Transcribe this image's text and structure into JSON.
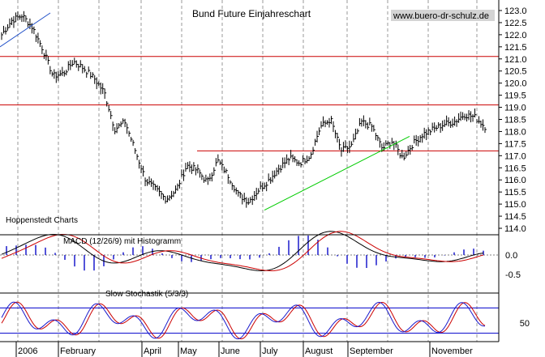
{
  "chart_data": [
    {
      "type": "line",
      "title": "Bund Future Einjahreschart",
      "source": "www.buero-dr-schulz.de",
      "publisher": "Hoppenstedt Charts",
      "ylim": [
        114.0,
        123.5
      ],
      "y_ticks": [
        "123.0",
        "122.5",
        "122.0",
        "121.5",
        "121.0",
        "120.5",
        "120.0",
        "119.5",
        "119.0",
        "118.5",
        "118.0",
        "117.5",
        "117.0",
        "116.5",
        "116.0",
        "115.5",
        "115.0",
        "114.5",
        "114.0"
      ],
      "x_labels": [
        "2006",
        "February",
        "April",
        "May",
        "June",
        "July",
        "August",
        "September",
        "November"
      ],
      "series": [
        {
          "values": [
            122.0,
            122.6,
            122.8,
            122.3,
            121.4,
            120.3,
            120.4,
            120.9,
            120.6,
            120.2,
            119.6,
            118.1,
            118.4,
            117.2,
            116.0,
            115.6,
            115.2,
            115.6,
            116.6,
            116.4,
            115.9,
            116.8,
            116.2,
            115.4,
            115.1,
            115.6,
            116.0,
            116.5,
            116.9,
            116.7,
            117.0,
            118.2,
            118.5,
            117.2,
            117.4,
            118.4,
            118.2,
            117.3,
            117.6,
            116.9,
            117.5,
            117.9,
            118.1,
            118.3,
            118.4,
            118.7,
            118.6,
            118.2
          ]
        }
      ],
      "horizontal_lines": [
        121.1,
        119.1,
        117.2
      ],
      "trendlines": [
        {
          "color": "#2050c8",
          "from": [
            0,
            121.7
          ],
          "to": [
            8,
            123.1
          ]
        },
        {
          "color": "#00cc00",
          "from": [
            60,
            114.8
          ],
          "to": [
            160,
            117.7
          ]
        }
      ]
    },
    {
      "type": "line",
      "title": "MACD (12/26/9) mit Histogramm",
      "ylim": [
        -0.8,
        0.7
      ],
      "y_ticks": [
        "0.0",
        "-0.5"
      ]
    },
    {
      "type": "line",
      "title": "Slow Stochastik (5/3/3)",
      "ylim": [
        0,
        100
      ],
      "y_ticks": [
        "50"
      ]
    }
  ],
  "colors": {
    "price": "#000000",
    "hline": "#cc0000",
    "signal": "#cc0000",
    "histogram": "#1a1acc",
    "stoch_band": "#0000cc",
    "grid": "#9a9a9a"
  }
}
